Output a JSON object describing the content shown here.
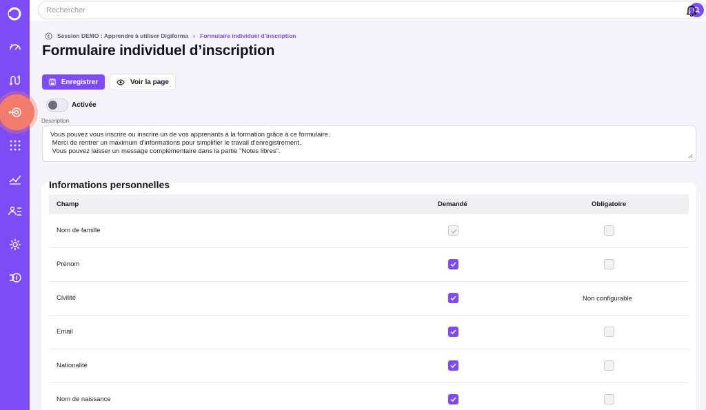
{
  "colors": {
    "accent": "#7e4cf5",
    "active_nav": "#f27b6b",
    "background": "#f4f3fa"
  },
  "sidebar": {
    "items": [
      {
        "icon": "logo-icon"
      },
      {
        "icon": "gauge-icon"
      },
      {
        "icon": "route-euro-icon"
      },
      {
        "icon": "target-icon",
        "active": true
      },
      {
        "icon": "dots-grid-icon"
      },
      {
        "icon": "chart-growth-icon"
      },
      {
        "icon": "user-list-icon"
      },
      {
        "icon": "gear-icon"
      },
      {
        "icon": "hand-coin-icon"
      }
    ]
  },
  "search": {
    "placeholder": "Rechercher"
  },
  "breadcrumb": {
    "parent": "Session DEMO : Apprendre à utiliser Digiforma",
    "current": "Formulaire individuel d’inscription"
  },
  "page": {
    "title": "Formulaire individuel d’inscription"
  },
  "toolbar": {
    "save_label": "Enregistrer",
    "view_label": "Voir la page"
  },
  "toggle": {
    "label": "Activée",
    "on": false
  },
  "description": {
    "label": "Description",
    "lines": [
      "Vous pouvez vous inscrire ou inscrire un de vos apprenants à la formation grâce à ce formulaire.",
      " Merci de rentrer un maximum d'informations pour simplifier le travail d'enregistrement.",
      " Vous pouvez laisser un message complémentaire dans la partie \"Notes libres\"."
    ]
  },
  "section": {
    "title": "Informations personnelles",
    "columns": [
      "Champ",
      "Demandé",
      "Obligatoire"
    ],
    "rows": [
      {
        "label": "Nom de famille",
        "requested": "disabled-checked",
        "required": "unchecked"
      },
      {
        "label": "Prénom",
        "requested": "checked",
        "required": "unchecked"
      },
      {
        "label": "Civilité",
        "requested": "checked",
        "required": "Non configurable"
      },
      {
        "label": "Email",
        "requested": "checked",
        "required": "unchecked"
      },
      {
        "label": "Nationalité",
        "requested": "checked",
        "required": "unchecked"
      },
      {
        "label": "Nom de naissance",
        "requested": "checked",
        "required": "unchecked"
      }
    ]
  }
}
